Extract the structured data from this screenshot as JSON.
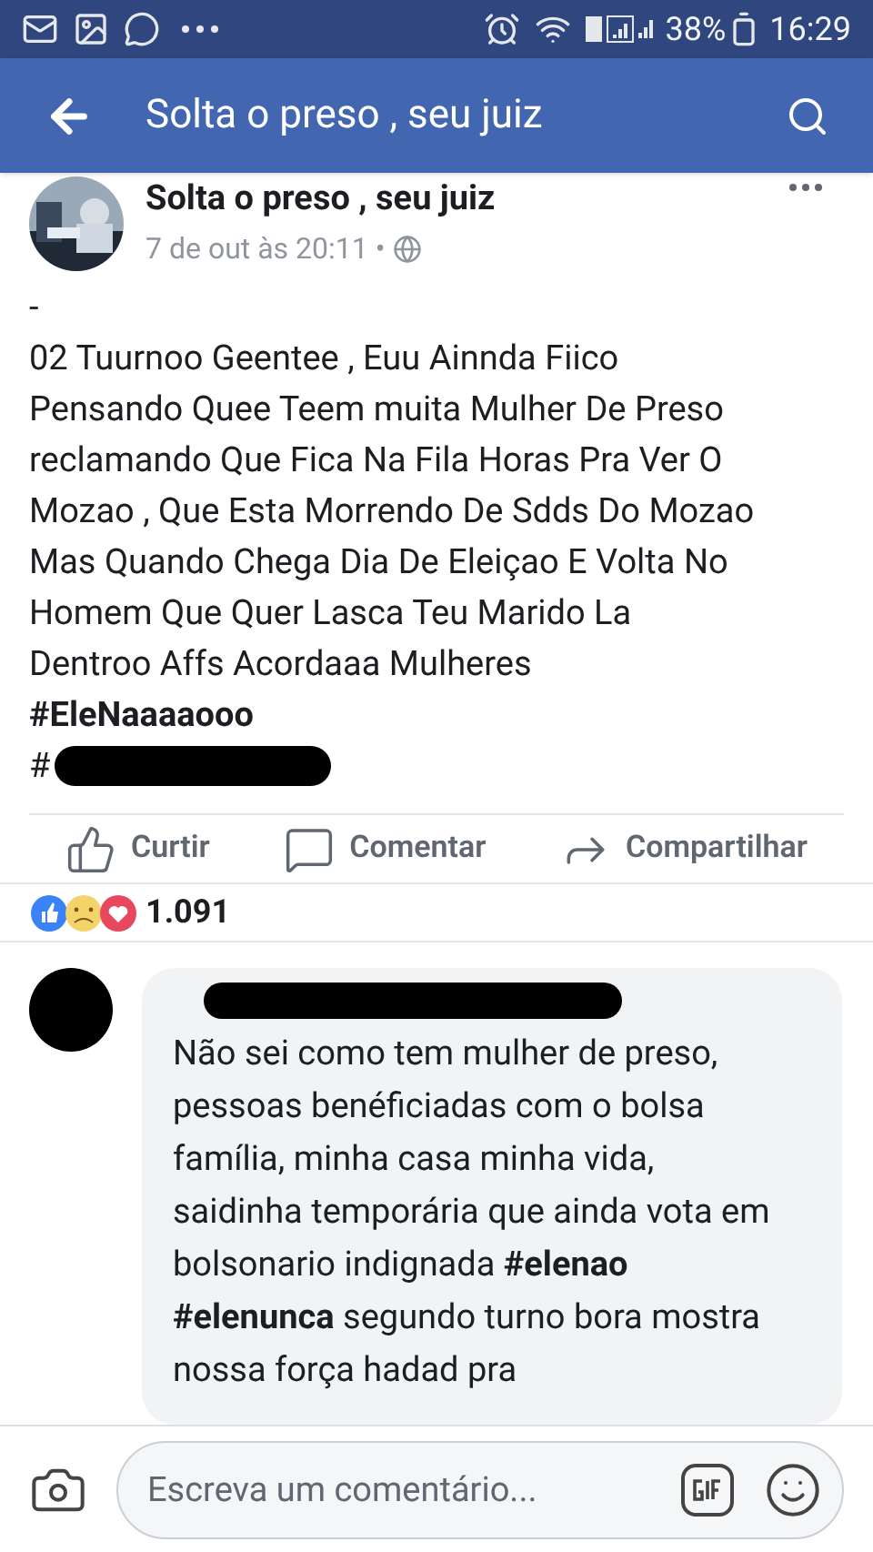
{
  "status_bar": {
    "battery": "38%",
    "time": "16:29"
  },
  "app_bar": {
    "title": "Solta o preso , seu juiz"
  },
  "post": {
    "author": "Solta o preso , seu juiz",
    "time": "7 de out às 20:11 •",
    "lines": [
      "-",
      "02 Tuurnoo Geentee , Euu Ainnda Fiico",
      "Pensando Quee Teem muita Mulher De Preso",
      "reclamando Que Fica Na Fila Horas Pra Ver O",
      "Mozao , Que Esta Morrendo De Sdds Do Mozao",
      "Mas Quando Chega Dia De Eleiçao E Volta No",
      "Homem Que Quer Lasca Teu Marido La",
      "Dentroo Affs Acordaaa Mulheres"
    ],
    "hashtag": "#EleNaaaaooo",
    "hidden_hashtag_prefix": "#"
  },
  "actions": [
    {
      "kind": "like",
      "label": "Curtir"
    },
    {
      "kind": "comment",
      "label": "Comentar"
    },
    {
      "kind": "share",
      "label": "Compartilhar"
    }
  ],
  "reactions": {
    "count": "1.091"
  },
  "comment": {
    "text": "Não sei como tem mulher de preso, pessoas benéficiadas com o bolsa família, minha casa minha vida, saidinha temporária que ainda vota em bolsonario indignada **#elenao** **#elenunca** segundo turno bora mostra nossa força hadad pra"
  },
  "composer": {
    "placeholder": "Escreva um comentário..."
  }
}
